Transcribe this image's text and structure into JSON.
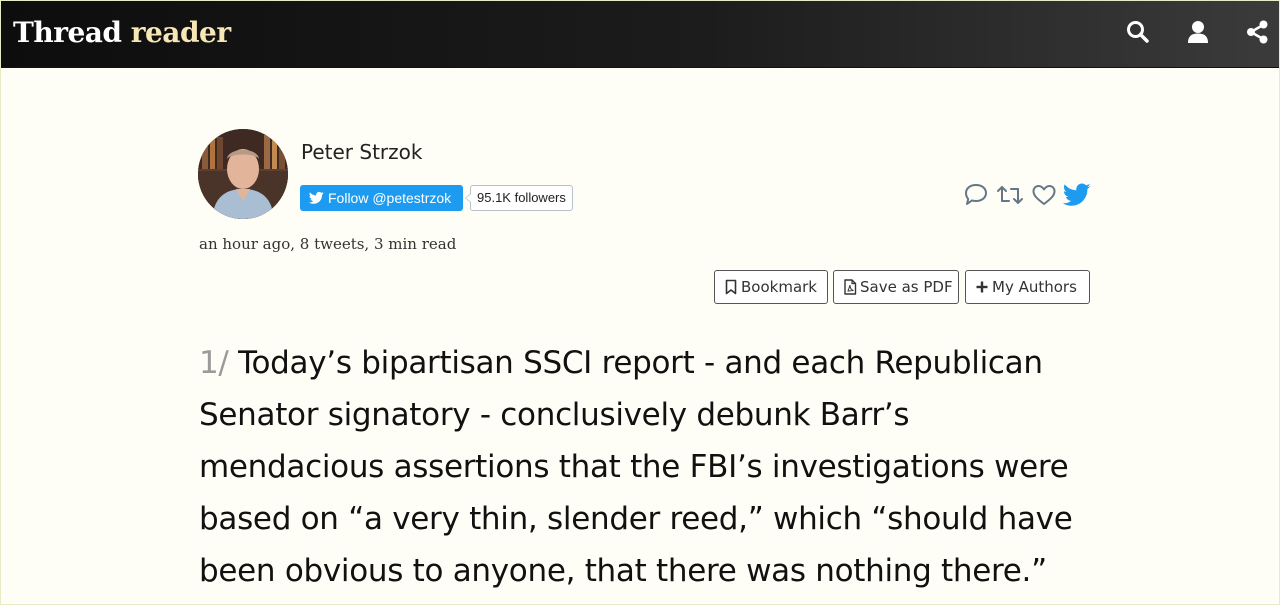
{
  "header": {
    "brand_part1": "Thread",
    "brand_part2": "reader",
    "icons": [
      "search-icon",
      "user-icon",
      "share-icon"
    ]
  },
  "author": {
    "name": "Peter Strzok",
    "follow_label": "Follow @petestrzok",
    "followers": "95.1K followers",
    "avatar_icon": "avatar-photo"
  },
  "thread": {
    "meta": "an hour ago, 8 tweets, 3 min read",
    "actions": [
      "reply-icon",
      "retweet-icon",
      "like-icon",
      "twitter-bird-icon"
    ]
  },
  "toolbar": {
    "bookmark_label": "Bookmark",
    "save_pdf_label": "Save as PDF",
    "my_authors_label": "My Authors"
  },
  "tweets": [
    {
      "number": "1/",
      "text": "Today’s bipartisan SSCI report - and each Republican Senator signatory - conclusively debunk Barr’s mendacious assertions that the FBI’s investigations were based on “a very thin, slender reed,” which “should have been obvious to anyone, that there was nothing there.”"
    }
  ],
  "colors": {
    "page_bg": "#fffef6",
    "header_bg": "#111111",
    "brand_accent": "#f7e7b4",
    "twitter_blue": "#1d9bf0",
    "tweet_number": "#9b9b9b"
  }
}
